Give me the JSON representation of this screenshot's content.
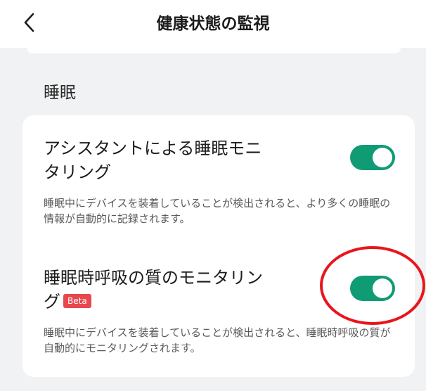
{
  "header": {
    "title": "健康状態の監視"
  },
  "section": {
    "title": "睡眠"
  },
  "items": [
    {
      "title": "アシスタントによる睡眠モニタリング",
      "description": "睡眠中にデバイスを装着していることが検出されると、より多くの睡眠の情報が自動的に記録されます。",
      "enabled": true
    },
    {
      "title": "睡眠時呼吸の質のモニタリング",
      "badge": "Beta",
      "description": "睡眠中にデバイスを装着していることが検出されると、睡眠時呼吸の質が自動的にモニタリングされます。",
      "enabled": true
    }
  ],
  "colors": {
    "toggle_on": "#0f9b73",
    "beta_badge": "#e8474e",
    "annotation_circle": "#e8161c"
  },
  "icons": {
    "back": "chevron-left-icon"
  }
}
